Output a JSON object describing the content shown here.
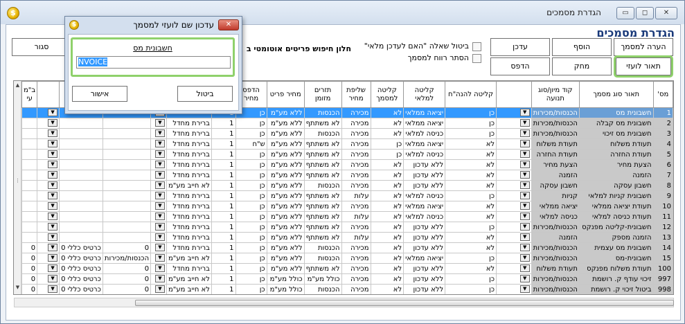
{
  "window": {
    "title": "הגדרת מסמכים",
    "min_label": "▭",
    "max_label": "◻",
    "close_label": "✕",
    "icon": "app-coin-icon",
    "icon_glyph": "$"
  },
  "page_title": "הגדרת מסמכים",
  "buttons": {
    "close": "סגור",
    "update": "עדכן",
    "add": "הוסף",
    "doc_note": "הערה למסמך",
    "print": "הדפס",
    "delete": "מחק",
    "foreign_desc": "תאור לועזי"
  },
  "options": {
    "cancel_update_question": "ביטול שאלה \"האם לעדכן מלאי\"",
    "hide_doc_profit": "הסתר רווח למסמך",
    "auto_search_window": "חלון חיפוש פריטים אוטומטי ב"
  },
  "grid": {
    "headers": [
      "מס'",
      "תאור סוג מסמך",
      "קוד מיון/סוג תנועה",
      "קליטה להנה\"ח",
      "קליטה למלאי",
      "קליטה למסמך",
      "שליפת מחיר",
      "תזרים מזומן",
      "מחיר פריט",
      "הדפס מחיר",
      "מספר העתק",
      "",
      "",
      "",
      "ב\"מ עי"
    ],
    "rows": [
      {
        "num": "1",
        "desc": "חשבונית מס",
        "sort": "הכנסות/מכירות",
        "acct": "כן",
        "inv": "יציאה ממלאי",
        "doc": "לא",
        "price": "מכירה",
        "cash": "הכנסות",
        "item": "ללא מע\"מ",
        "print": "כן",
        "copies": "1",
        "c11": "",
        "c12": "",
        "c13": "",
        "c14": "",
        "selected": true
      },
      {
        "num": "2",
        "desc": "חשבונית מס קבלה",
        "sort": "הכנסות/מכירות",
        "acct": "כן",
        "inv": "יציאה ממלאי",
        "doc": "לא",
        "price": "מכירה",
        "cash": "לא משתתף",
        "item": "ללא מע\"מ",
        "print": "כן",
        "copies": "1",
        "c11": "ברירת מחדל",
        "c12": "",
        "c13": "",
        "c14": ""
      },
      {
        "num": "3",
        "desc": "חשבונית מס זיכוי",
        "sort": "הכנסות/מכירות",
        "acct": "כן",
        "inv": "כניסה למלאי",
        "doc": "לא",
        "price": "מכירה",
        "cash": "הכנסות",
        "item": "ללא מע\"מ",
        "print": "כן",
        "copies": "1",
        "c11": "ברירת מחדל",
        "c12": "",
        "c13": "",
        "c14": ""
      },
      {
        "num": "4",
        "desc": "תעודת משלוח",
        "sort": "תעודת משלוח",
        "acct": "לא",
        "inv": "יציאה ממלאי",
        "doc": "כן",
        "price": "מכירה",
        "cash": "לא משתתף",
        "item": "ללא מע\"מ",
        "print": "ש\"ח",
        "copies": "1",
        "c11": "ברירת מחדל",
        "c12": "",
        "c13": "",
        "c14": ""
      },
      {
        "num": "5",
        "desc": "תעודת החזרה",
        "sort": "תעודת החזרה",
        "acct": "לא",
        "inv": "כניסה למלאי",
        "doc": "כן",
        "price": "מכירה",
        "cash": "לא משתתף",
        "item": "ללא מע\"מ",
        "print": "כן",
        "copies": "1",
        "c11": "ברירת מחדל",
        "c12": "",
        "c13": "",
        "c14": ""
      },
      {
        "num": "6",
        "desc": "הצעת מחיר",
        "sort": "הצעת מחיר",
        "acct": "לא",
        "inv": "ללא עדכון",
        "doc": "לא",
        "price": "מכירה",
        "cash": "לא משתתף",
        "item": "ללא מע\"מ",
        "print": "כן",
        "copies": "1",
        "c11": "ברירת מחדל",
        "c12": "",
        "c13": "",
        "c14": ""
      },
      {
        "num": "7",
        "desc": "הזמנה",
        "sort": "הזמנה",
        "acct": "לא",
        "inv": "ללא עדכון",
        "doc": "לא",
        "price": "מכירה",
        "cash": "לא משתתף",
        "item": "ללא מע\"מ",
        "print": "כן",
        "copies": "1",
        "c11": "ברירת מחדל",
        "c12": "",
        "c13": "",
        "c14": ""
      },
      {
        "num": "8",
        "desc": "חשבון עסקה",
        "sort": "חשבון עסקה",
        "acct": "לא",
        "inv": "ללא עדכון",
        "doc": "לא",
        "price": "מכירה",
        "cash": "הכנסות",
        "item": "ללא מע\"מ",
        "print": "כן",
        "copies": "1",
        "c11": "לא חייב מע\"מ",
        "c12": "",
        "c13": "",
        "c14": ""
      },
      {
        "num": "9",
        "desc": "חשבונית קניות למלאי",
        "sort": "קניות",
        "acct": "כן",
        "inv": "כניסה למלאי",
        "doc": "לא",
        "price": "עלות",
        "cash": "לא משתתף",
        "item": "ללא מע\"מ",
        "print": "כן",
        "copies": "1",
        "c11": "ברירת מחדל",
        "c12": "",
        "c13": "",
        "c14": ""
      },
      {
        "num": "10",
        "desc": "תעודת יציאה ממלאי",
        "sort": "יציאה ממלאי",
        "acct": "לא",
        "inv": "יציאה ממלאי",
        "doc": "לא",
        "price": "מכירה",
        "cash": "לא משתתף",
        "item": "ללא מע\"מ",
        "print": "כן",
        "copies": "1",
        "c11": "ברירת מחדל",
        "c12": "",
        "c13": "",
        "c14": ""
      },
      {
        "num": "11",
        "desc": "תעודת כניסה למלאי",
        "sort": "כניסה למלאי",
        "acct": "לא",
        "inv": "כניסה למלאי",
        "doc": "לא",
        "price": "עלות",
        "cash": "לא משתתף",
        "item": "ללא מע\"מ",
        "print": "כן",
        "copies": "1",
        "c11": "ברירת מחדל",
        "c12": "",
        "c13": "",
        "c14": ""
      },
      {
        "num": "12",
        "desc": "חשבונית-קליטה מפנקס",
        "sort": "הכנסות/מכירות",
        "acct": "כן",
        "inv": "ללא עדכון",
        "doc": "לא",
        "price": "מכירה",
        "cash": "לא משתתף",
        "item": "ללא מע\"מ",
        "print": "כן",
        "copies": "1",
        "c11": "ברירת מחדל",
        "c12": "",
        "c13": "",
        "c14": ""
      },
      {
        "num": "13",
        "desc": "הזמנה מספק",
        "sort": "הזמנה",
        "acct": "לא",
        "inv": "ללא עדכון",
        "doc": "לא",
        "price": "עלות",
        "cash": "לא משתתף",
        "item": "ללא מע\"מ",
        "print": "כן",
        "copies": "1",
        "c11": "ברירת מחדל",
        "c12": "",
        "c13": "",
        "c14": ""
      },
      {
        "num": "14",
        "desc": "חשבונית מס עצמית",
        "sort": "הכנסות/מכירות",
        "acct": "לא",
        "inv": "ללא עדכון",
        "doc": "לא",
        "price": "מכירה",
        "cash": "הכנסות",
        "item": "ללא מע\"מ",
        "print": "כן",
        "copies": "1",
        "c11": "ברירת מחדל",
        "c12": "0",
        "c13": "כרטיס כללי 0",
        "c14": "0"
      },
      {
        "num": "15",
        "desc": "חשבונית-מס",
        "sort": "הכנסות/מכירות",
        "acct": "כן",
        "inv": "יציאה ממלאי",
        "doc": "לא",
        "price": "מכירה",
        "cash": "הכנסות",
        "item": "ללא מע\"מ",
        "print": "כן",
        "copies": "1",
        "c11": "לא חייב מע\"מ",
        "c12": "הכנסות/מכירות",
        "c13": "כרטיס כללי 0",
        "c14": "0"
      },
      {
        "num": "100",
        "desc": "תעודת משלוח מפנקס",
        "sort": "תעודת משלוח",
        "acct": "לא",
        "inv": "ללא עדכון",
        "doc": "לא",
        "price": "מכירה",
        "cash": "לא משתתף",
        "item": "ללא מע\"מ",
        "print": "כן",
        "copies": "1",
        "c11": "ברירת מחדל",
        "c12": "0",
        "c13": "כרטיס כללי 0",
        "c14": "0"
      },
      {
        "num": "997",
        "desc": "זיכוי עודף ק. רושמת",
        "sort": "הכנסות/מכירות",
        "acct": "כן",
        "inv": "ללא עדכון",
        "doc": "לא",
        "price": "מכירה",
        "cash": "כולל מע\"מ",
        "item": "כולל מע\"מ",
        "print": "כן",
        "copies": "1",
        "c11": "לא חייב מע\"מ",
        "c12": "0",
        "c13": "כרטיס כללי 0",
        "c14": "0"
      },
      {
        "num": "998",
        "desc": "ביטול זיכוי ק. רושמת",
        "sort": "הכנסות/מכירות",
        "acct": "כן",
        "inv": "ללא עדכון",
        "doc": "לא",
        "price": "מכירה",
        "cash": "הכנסות",
        "item": "כולל מע\"מ",
        "print": "כן",
        "copies": "1",
        "c11": "לא חייב מע\"מ",
        "c12": "0",
        "c13": "כרטיס כללי 0",
        "c14": "0"
      }
    ]
  },
  "scrollbar": {
    "grip": "⋮",
    "hgrip": "|||",
    "up": "▲",
    "down": "▼",
    "left": "◂",
    "right": "▸"
  },
  "dialog": {
    "title": "עדכון שם לועזי למסמך",
    "close": "✕",
    "icon_glyph": "$",
    "field_label": "חשבונית מס",
    "field_value": "NVOICE",
    "ok": "אישור",
    "cancel": "ביטול"
  },
  "colors": {
    "selection": "#3399ff",
    "highlight_outline": "#8fd16b",
    "title_blue": "#1a3a7a"
  }
}
